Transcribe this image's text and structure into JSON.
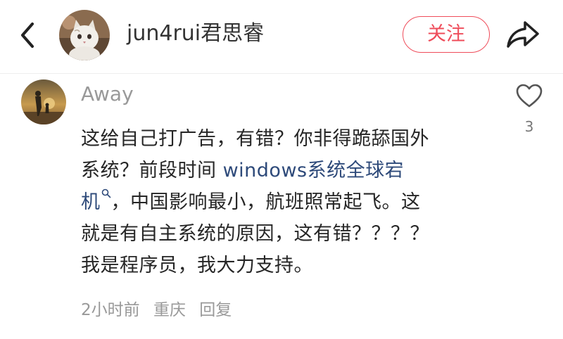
{
  "header": {
    "username": "jun4rui君思睿",
    "follow_label": "关注",
    "accent_color": "#ef4c5a",
    "icons": {
      "back": "chevron-left-icon",
      "share": "share-arrow-icon"
    }
  },
  "comment": {
    "author": "Away",
    "body_lines": [
      "这给自己打广告，有错？你非得跪舔国外",
      "系统？前段时间 "
    ],
    "search_link_text_1": "windows系统全球宕",
    "search_link_text_2": "机",
    "body_after_link": "，中国影响最小，航班照常起飞。这",
    "body_lines_end": [
      "就是有自主系统的原因，这有错？？？？",
      "我是程序员，我大力支持。"
    ],
    "like_count": "3",
    "time": "2小时前",
    "location": "重庆",
    "reply_label": "回复",
    "link_color": "#2e4a7a",
    "icons": {
      "like": "heart-outline-icon",
      "search": "search-magnifier-icon"
    }
  }
}
